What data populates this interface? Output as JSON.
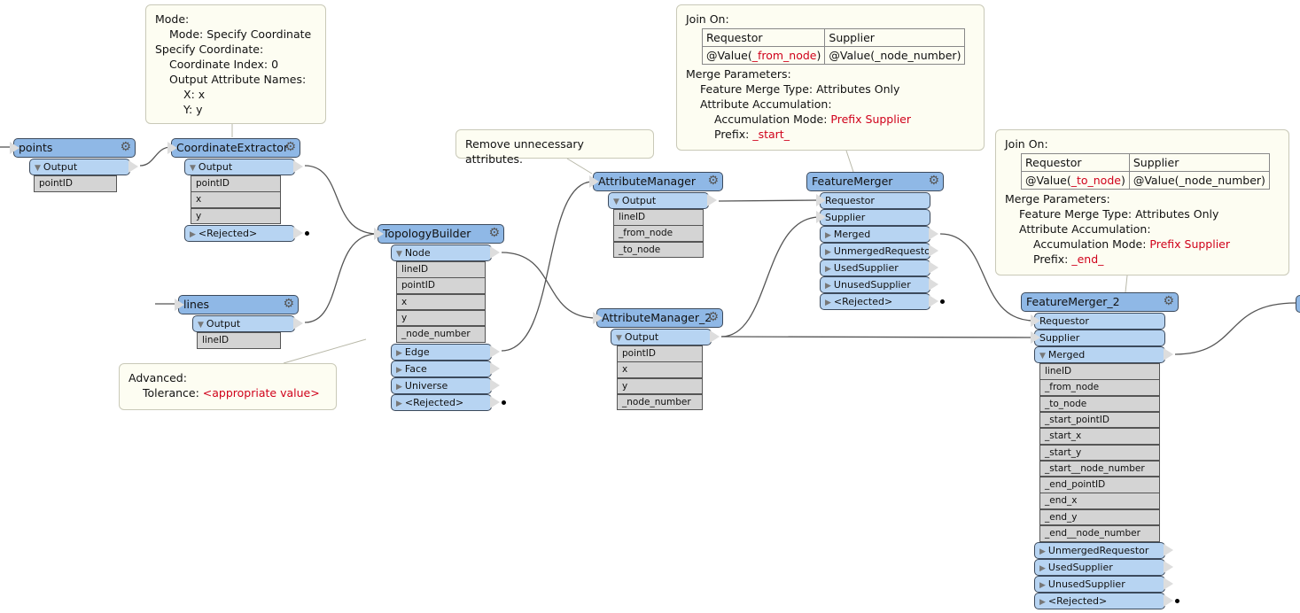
{
  "transformers": [
    {
      "name": "points",
      "inputs": [],
      "outputs": [
        {
          "label": "Output",
          "expanded": true,
          "attrs": [
            "pointID"
          ]
        }
      ]
    },
    {
      "name": "CoordinateExtractor",
      "inputs": [],
      "outputs": [
        {
          "label": "Output",
          "expanded": true,
          "attrs": [
            "pointID",
            "x",
            "y"
          ]
        },
        {
          "label": "<Rejected>",
          "expanded": false,
          "attrs": []
        }
      ]
    },
    {
      "name": "lines",
      "inputs": [],
      "outputs": [
        {
          "label": "Output",
          "expanded": true,
          "attrs": [
            "lineID"
          ]
        }
      ]
    },
    {
      "name": "TopologyBuilder",
      "inputs": [],
      "outputs": [
        {
          "label": "Node",
          "expanded": true,
          "attrs": [
            "lineID",
            "pointID",
            "x",
            "y",
            "_node_number"
          ]
        },
        {
          "label": "Edge",
          "expanded": false,
          "attrs": []
        },
        {
          "label": "Face",
          "expanded": false,
          "attrs": []
        },
        {
          "label": "Universe",
          "expanded": false,
          "attrs": []
        },
        {
          "label": "<Rejected>",
          "expanded": false,
          "attrs": []
        }
      ]
    },
    {
      "name": "AttributeManager",
      "inputs": [],
      "outputs": [
        {
          "label": "Output",
          "expanded": true,
          "attrs": [
            "lineID",
            "_from_node",
            "_to_node"
          ]
        }
      ]
    },
    {
      "name": "AttributeManager_2",
      "inputs": [],
      "outputs": [
        {
          "label": "Output",
          "expanded": true,
          "attrs": [
            "pointID",
            "x",
            "y",
            "_node_number"
          ]
        }
      ]
    },
    {
      "name": "FeatureMerger",
      "inputs": [
        "Requestor",
        "Supplier"
      ],
      "outputs": [
        {
          "label": "Merged",
          "expanded": false,
          "attrs": []
        },
        {
          "label": "UnmergedRequestor",
          "expanded": false,
          "attrs": []
        },
        {
          "label": "UsedSupplier",
          "expanded": false,
          "attrs": []
        },
        {
          "label": "UnusedSupplier",
          "expanded": false,
          "attrs": []
        },
        {
          "label": "<Rejected>",
          "expanded": false,
          "attrs": []
        }
      ]
    },
    {
      "name": "FeatureMerger_2",
      "inputs": [
        "Requestor",
        "Supplier"
      ],
      "outputs": [
        {
          "label": "Merged",
          "expanded": true,
          "attrs": [
            "lineID",
            "_from_node",
            "_to_node",
            "_start_pointID",
            "_start_x",
            "_start_y",
            "_start__node_number",
            "_end_pointID",
            "_end_x",
            "_end_y",
            "_end__node_number"
          ]
        },
        {
          "label": "UnmergedRequestor",
          "expanded": false,
          "attrs": []
        },
        {
          "label": "UsedSupplier",
          "expanded": false,
          "attrs": []
        },
        {
          "label": "UnusedSupplier",
          "expanded": false,
          "attrs": []
        },
        {
          "label": "<Rejected>",
          "expanded": false,
          "attrs": []
        }
      ]
    }
  ],
  "annotations": {
    "coord": {
      "l1": "Mode:",
      "l2": "Mode: Specify Coordinate",
      "l3": "Specify Coordinate:",
      "l4": "Coordinate Index: 0",
      "l5": "Output Attribute Names:",
      "l6": "X: x",
      "l7": "Y: y"
    },
    "remove": {
      "text": "Remove unnecessary attributes."
    },
    "fm1": {
      "join": "Join On:",
      "h1": "Requestor",
      "h2": "Supplier",
      "v1a": "@Value(",
      "v1b": "_from_node",
      "v1c": ")",
      "v2": "@Value(_node_number)",
      "mp": "Merge Parameters:",
      "fmt": "Feature Merge Type: Attributes Only",
      "aa": "Attribute Accumulation:",
      "am": "Accumulation Mode: ",
      "amv": "Prefix Supplier",
      "pf": "Prefix: ",
      "pfv": "_start_"
    },
    "fm2": {
      "join": "Join On:",
      "h1": "Requestor",
      "h2": "Supplier",
      "v1a": "@Value(",
      "v1b": "_to_node",
      "v1c": ")",
      "v2": "@Value(_node_number)",
      "mp": "Merge Parameters:",
      "fmt": "Feature Merge Type: Attributes Only",
      "aa": "Attribute Accumulation:",
      "am": "Accumulation Mode: ",
      "amv": "Prefix Supplier",
      "pf": "Prefix: ",
      "pfv": "_end_"
    },
    "adv": {
      "l1": "Advanced:",
      "l2": "Tolerance: ",
      "l2v": "<appropriate value>"
    }
  },
  "colors": {
    "header": "#8fb8e6",
    "port": "#b7d4f2",
    "attr": "#d4d4d4",
    "annotation": "#fdfdf2",
    "parameter": "#d0021b"
  }
}
